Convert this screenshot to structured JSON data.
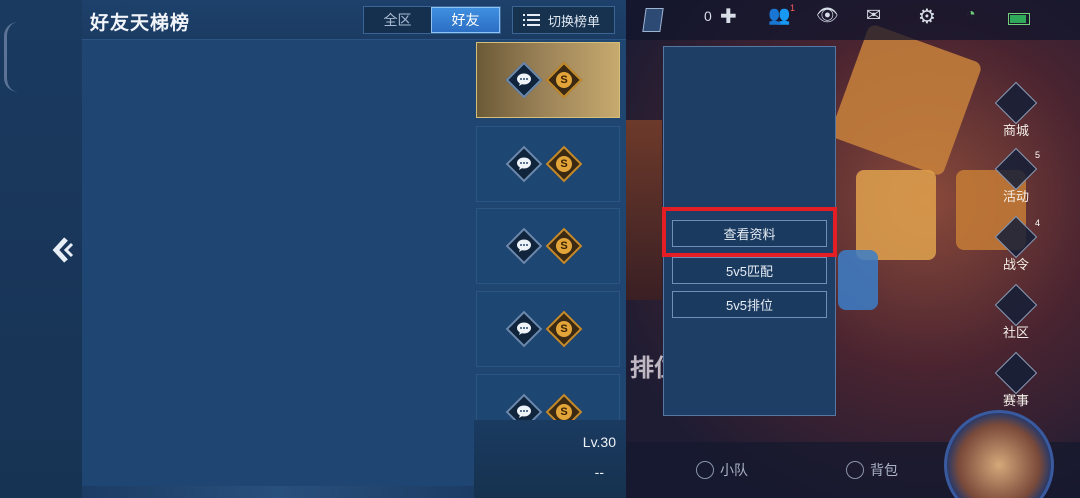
{
  "panel": {
    "title": "好友天梯榜",
    "tabs": [
      {
        "label": "全区",
        "active": false
      },
      {
        "label": "好友",
        "active": true
      }
    ],
    "switch_label": "切换榜单",
    "level": "Lv.30",
    "dash": "--"
  },
  "rows": [
    {
      "highlighted": true
    },
    {
      "highlighted": false
    },
    {
      "highlighted": false
    },
    {
      "highlighted": false
    },
    {
      "highlighted": false
    }
  ],
  "gift_glyph": "S",
  "game": {
    "coins": "0",
    "friend_badge": "1",
    "side_menu": [
      {
        "label": "商城",
        "badge": ""
      },
      {
        "label": "活动",
        "badge": "5"
      },
      {
        "label": "战令",
        "badge": "4"
      },
      {
        "label": "社区",
        "badge": ""
      },
      {
        "label": "赛事",
        "badge": ""
      }
    ],
    "rank_text": "排位",
    "nav": {
      "team": "小队",
      "bag": "背包"
    }
  },
  "popup": {
    "view_profile": "查看资料",
    "match_5v5": "5v5匹配",
    "ranked_5v5": "5v5排位"
  },
  "colors": {
    "accent_tab": "#3f8fe0",
    "highlight_box": "#e51d24",
    "gold_row": "#c7aa6e"
  }
}
